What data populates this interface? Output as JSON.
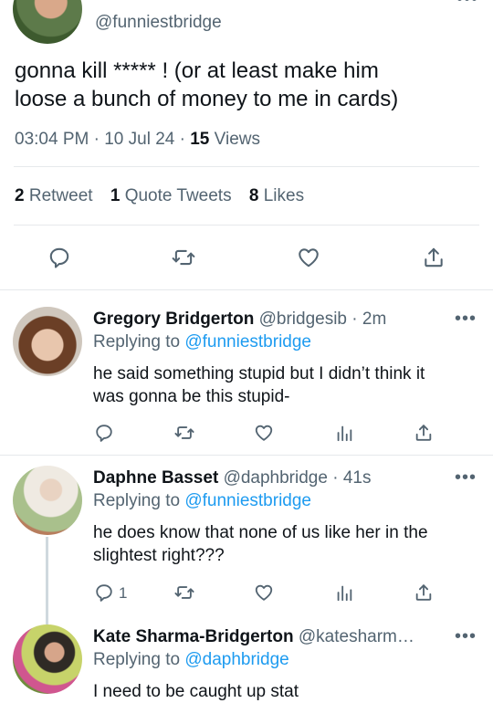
{
  "main_tweet": {
    "handle": "@funniestbridge",
    "text_line1": "gonna kill ***** ! (or at least make him",
    "text_line2": "loose a bunch of money to me in cards)",
    "time": "03:04 PM",
    "sep1": "·",
    "date": "10 Jul 24",
    "sep2": "·",
    "views_count": "15",
    "views_label": "Views",
    "stats": {
      "retweets_count": "2",
      "retweets_label": "Retweet",
      "quotes_count": "1",
      "quotes_label": "Quote Tweets",
      "likes_count": "8",
      "likes_label": "Likes"
    }
  },
  "replies": [
    {
      "name": "Gregory Bridgerton",
      "handle": "@bridgesib",
      "time": "· 2m",
      "replying_prefix": "Replying to",
      "replying_to": "@funniestbridge",
      "text_line1": "he said something stupid but I didn’t think it",
      "text_line2": "was gonna be this stupid-",
      "reply_count": ""
    },
    {
      "name": "Daphne Basset",
      "handle": "@daphbridge",
      "time": "· 41s",
      "replying_prefix": "Replying to",
      "replying_to": "@funniestbridge",
      "text_line1": "he does know that none of us like her in the",
      "text_line2": "slightest right???",
      "reply_count": "1"
    },
    {
      "name": "Kate Sharma-Bridgerton",
      "handle": "@katesharm…",
      "time": "",
      "replying_prefix": "Replying to",
      "replying_to": "@daphbridge",
      "text_line1": "I need to be caught up stat"
    }
  ],
  "colors": {
    "accent": "#1d9bf0",
    "muted": "#536471",
    "text": "#0f1419",
    "divider": "#e6e9ec"
  },
  "icons": [
    "reply-icon",
    "retweet-icon",
    "like-icon",
    "share-icon",
    "analytics-icon",
    "more-icon"
  ]
}
